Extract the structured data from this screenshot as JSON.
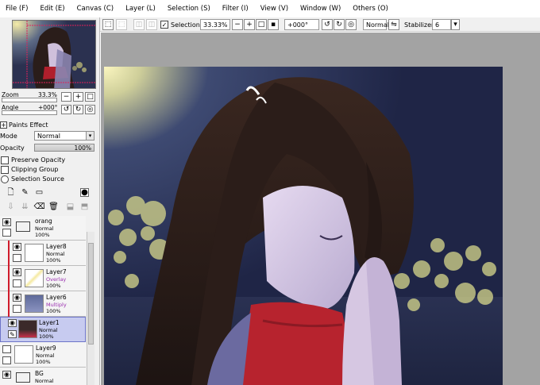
{
  "menu": {
    "items": [
      "File (F)",
      "Edit (E)",
      "Canvas (C)",
      "Layer (L)",
      "Selection (S)",
      "Filter (I)",
      "View (V)",
      "Window (W)",
      "Others (O)"
    ]
  },
  "toolbar": {
    "selection_label": "Selection",
    "zoom_value": "33.33%",
    "angle_value": "+000°",
    "blend_value": "Normal",
    "stabilizer_label": "Stabilizer",
    "stabilizer_value": "6"
  },
  "navigator": {
    "zoom_label": "Zoom",
    "zoom_value": "33.3%",
    "angle_label": "Angle",
    "angle_value": "+000°"
  },
  "layer_props": {
    "paints_effect": "Paints Effect",
    "mode_label": "Mode",
    "mode_value": "Normal",
    "opacity_label": "Opacity",
    "opacity_value": "100%",
    "preserve_opacity": "Preserve Opacity",
    "clipping_group": "Clipping Group",
    "selection_source": "Selection Source"
  },
  "layers": [
    {
      "name": "orang",
      "mode": "Normal",
      "opacity": "100%",
      "type": "folder",
      "clipped": false,
      "selected": false
    },
    {
      "name": "Layer8",
      "mode": "Normal",
      "opacity": "100%",
      "type": "layer",
      "clipped": true,
      "selected": false
    },
    {
      "name": "Layer7",
      "mode": "Overlay",
      "opacity": "100%",
      "type": "layer",
      "clipped": true,
      "selected": false
    },
    {
      "name": "Layer6",
      "mode": "Multiply",
      "opacity": "100%",
      "type": "layer",
      "clipped": true,
      "selected": false
    },
    {
      "name": "Layer1",
      "mode": "Normal",
      "opacity": "100%",
      "type": "layer",
      "clipped": false,
      "selected": true
    },
    {
      "name": "Layer9",
      "mode": "Normal",
      "opacity": "100%",
      "type": "layer",
      "clipped": false,
      "selected": false
    },
    {
      "name": "BG",
      "mode": "Normal",
      "opacity": "",
      "type": "folder",
      "clipped": false,
      "selected": false
    }
  ],
  "colors": {
    "panel_bg": "#f0f0f0",
    "selected_layer": "#c7cbf0",
    "clip_marker": "#d01c2c",
    "mode_accent": "#9a2fb0",
    "canvas_bg": "#a3a3a3"
  },
  "icons": {
    "menu_shortcut_prefix": "none",
    "navigator_buttons": [
      "zoom-out-icon",
      "zoom-in-icon",
      "zoom-reset-icon",
      "rotate-left-icon",
      "rotate-right-icon",
      "rotate-reset-icon"
    ],
    "layer_tools_row1": [
      "new-layer-icon",
      "new-linework-layer-icon",
      "new-folder-icon",
      "layer-mask-icon"
    ],
    "layer_tools_row2": [
      "transfer-down-icon",
      "merge-down-icon",
      "clear-layer-icon",
      "delete-layer-icon",
      "apply-mask-icon",
      "mask-off-icon"
    ]
  }
}
